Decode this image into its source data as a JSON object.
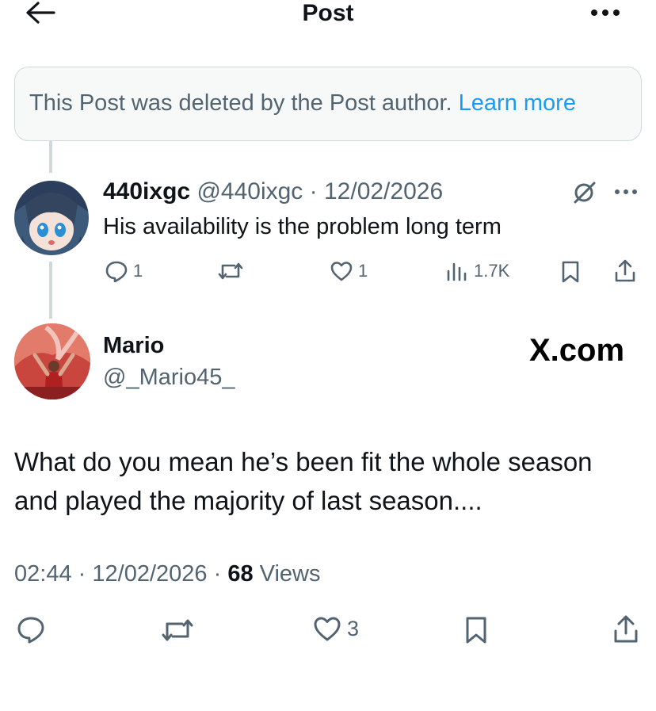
{
  "header": {
    "title": "Post"
  },
  "deleted_notice": {
    "text": "This Post was deleted by the Post author.",
    "link": "Learn more"
  },
  "reply": {
    "name": "440ixgc",
    "handle": "@440ixgc",
    "separator": "·",
    "date": "12/02/2026",
    "text": "His availability is the problem long term",
    "replies": "1",
    "likes": "1",
    "views": "1.7K"
  },
  "post": {
    "name": "Mario",
    "handle": "@_Mario45_",
    "watermark": "X.com",
    "text": "What do you mean he’s been fit the whole season and played the majority of last season....",
    "time": "02:44",
    "separator": "·",
    "date": "12/02/2026",
    "views_count": "68",
    "views_label": "Views",
    "likes": "3"
  },
  "colors": {
    "accent": "#1d9bf0",
    "muted": "#536471",
    "text": "#0f1419",
    "line": "#cfd9de"
  }
}
